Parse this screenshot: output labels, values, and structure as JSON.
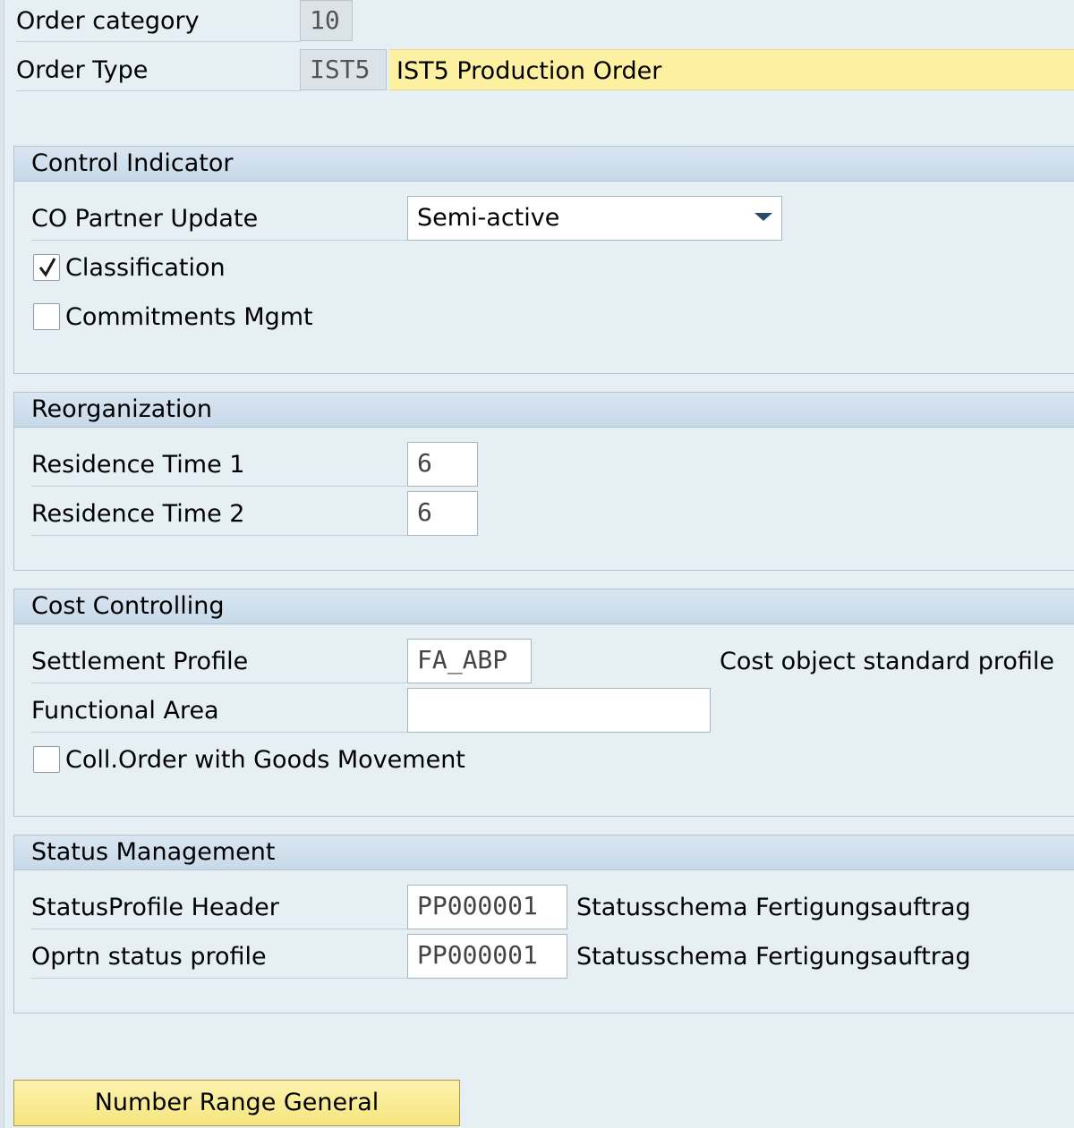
{
  "header": {
    "order_category_label": "Order category",
    "order_category_value": "10",
    "order_type_label": "Order Type",
    "order_type_code": "IST5",
    "order_type_desc": "IST5 Production Order"
  },
  "control_indicator": {
    "title": "Control Indicator",
    "co_partner_label": "CO Partner Update",
    "co_partner_value": "Semi-active",
    "classification_label": "Classification",
    "classification_checked": true,
    "commitments_label": "Commitments Mgmt",
    "commitments_checked": false
  },
  "reorganization": {
    "title": "Reorganization",
    "res1_label": "Residence Time 1",
    "res1_value": "6",
    "res2_label": "Residence Time 2",
    "res2_value": "6"
  },
  "cost_controlling": {
    "title": "Cost Controlling",
    "settlement_label": "Settlement Profile",
    "settlement_value": "FA_ABP",
    "settlement_desc": "Cost object standard profile",
    "functional_area_label": "Functional Area",
    "functional_area_value": "",
    "coll_order_label": "Coll.Order with Goods Movement",
    "coll_order_checked": false
  },
  "status_management": {
    "title": "Status Management",
    "header_profile_label": "StatusProfile Header",
    "header_profile_value": "PP000001",
    "header_profile_desc": "Statusschema Fertigungsauftrag",
    "oprtn_profile_label": "Oprtn status profile",
    "oprtn_profile_value": "PP000001",
    "oprtn_profile_desc": "Statusschema Fertigungsauftrag"
  },
  "buttons": {
    "number_range_label": "Number Range General"
  },
  "icons": {
    "dropdown": "chevron-down-icon",
    "checkmark": "checkmark-icon"
  },
  "colors": {
    "background": "#e6eff4",
    "group_header": "#c7d9e8",
    "highlight_yellow": "#fdf0a0"
  }
}
